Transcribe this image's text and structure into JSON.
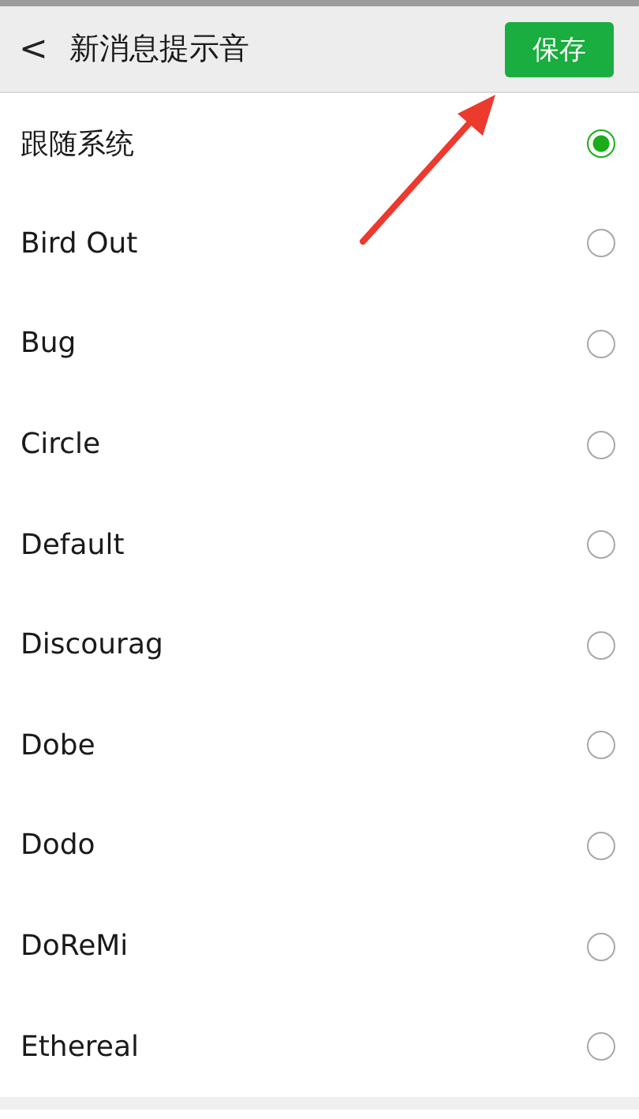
{
  "header": {
    "back": "<",
    "title": "新消息提示音",
    "save_button": "保存"
  },
  "sounds": [
    {
      "name": "跟随系统",
      "selected": true
    },
    {
      "name": "Bird Out",
      "selected": false
    },
    {
      "name": "Bug",
      "selected": false
    },
    {
      "name": "Circle",
      "selected": false
    },
    {
      "name": "Default",
      "selected": false
    },
    {
      "name": "Discourag",
      "selected": false
    },
    {
      "name": "Dobe",
      "selected": false
    },
    {
      "name": "Dodo",
      "selected": false
    },
    {
      "name": "DoReMi",
      "selected": false
    },
    {
      "name": "Ethereal",
      "selected": false
    }
  ]
}
